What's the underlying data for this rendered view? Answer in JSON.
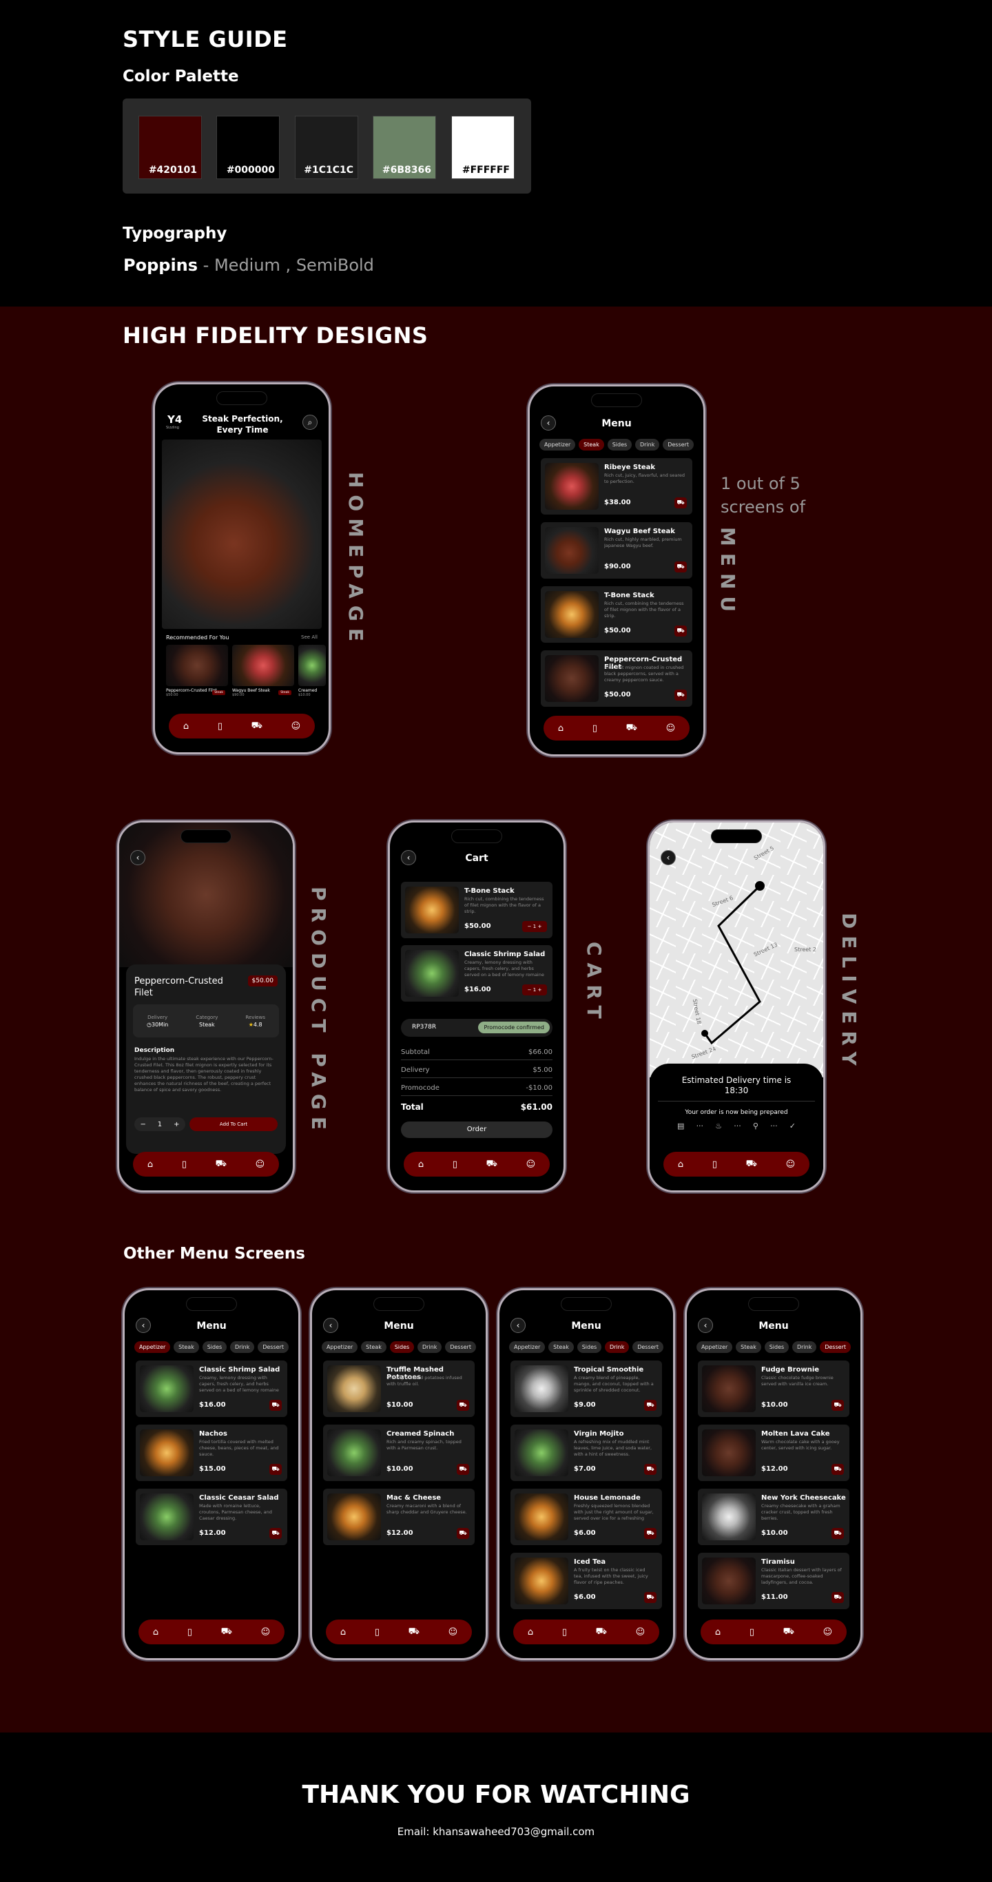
{
  "style_guide": {
    "title": "STYLE GUIDE",
    "palette_heading": "Color Palette",
    "colors": [
      "#420101",
      "#000000",
      "#1C1C1C",
      "#6B8366",
      "#FFFFFF"
    ],
    "typography_heading": "Typography",
    "font_name": "Poppins",
    "font_weights": " - Medium , SemiBold"
  },
  "hifi": {
    "title": "HIGH FIDELITY DESIGNS",
    "menu_note": "1 out of 5 screens of"
  },
  "labels": {
    "homepage": "HOMEPAGE",
    "menu": "MENU",
    "product": "PRODUCT PAGE",
    "cart": "CART",
    "delivery": "DELIVERY"
  },
  "home": {
    "logo": "Y4",
    "logo_sub": "Sizzling",
    "title": "Steak Perfection, Every Time",
    "recommended": "Recommended For You",
    "see_all": "See All",
    "items": [
      {
        "name": "Peppercorn-Crusted Filet",
        "price": "$50.00",
        "tag": "Steak"
      },
      {
        "name": "Wagyu Beef Steak",
        "price": "$90.00",
        "tag": "Steak"
      },
      {
        "name": "Creamed",
        "price": "$10.00"
      }
    ]
  },
  "menu_common": {
    "title": "Menu",
    "tabs": [
      "Appetizer",
      "Steak",
      "Sides",
      "Drink",
      "Dessert"
    ]
  },
  "menu_steak": [
    {
      "name": "Ribeye Steak",
      "desc": "Rich cut, juicy, flavorful, and seared to perfection.",
      "price": "$38.00"
    },
    {
      "name": "Wagyu Beef Steak",
      "desc": "Rich cut, highly marbled, premium Japanese Wagyu beef.",
      "price": "$90.00"
    },
    {
      "name": "T-Bone Stack",
      "desc": "Rich cut, combining the tenderness of filet mignon with the flavor of a strip.",
      "price": "$50.00"
    },
    {
      "name": "Peppercorn-Crusted Filet",
      "desc": "Rich filet mignon coated in crushed black peppercorns, served with a creamy peppercorn sauce.",
      "price": "$50.00"
    }
  ],
  "product": {
    "name": "Peppercorn-Crusted Filet",
    "price": "$50.00",
    "delivery_label": "Delivery",
    "delivery_value": "30Min",
    "category_label": "Category",
    "category_value": "Steak",
    "reviews_label": "Reviews",
    "reviews_value": "4.8",
    "desc_heading": "Description",
    "desc": "Indulge in the ultimate steak experience with our Peppercorn-Crusted Filet. This 8oz filet mignon is expertly selected for its tenderness and flavor, then generously coated in freshly crushed black peppercorns. The robust, peppery crust enhances the natural richness of the beef, creating a perfect balance of spice and savory goodness.",
    "qty": "1",
    "add_label": "Add To Cart"
  },
  "cart": {
    "title": "Cart",
    "items": [
      {
        "name": "T-Bone Stack",
        "desc": "Rich cut, combining the tenderness of filet mignon with the flavor of a strip.",
        "price": "$50.00",
        "qty": "1"
      },
      {
        "name": "Classic Shrimp Salad",
        "desc": "Creamy, lemony dressing with capers, fresh celery, and herbs served on a bed of lemony romaine lettuce.",
        "price": "$16.00",
        "qty": "1"
      }
    ],
    "promo_code": "RP378R",
    "promo_status": "Promocode confirmed",
    "subtotal_label": "Subtotal",
    "subtotal": "$66.00",
    "delivery_label": "Delivery",
    "delivery": "$5.00",
    "promo_label": "Promocode",
    "promo": "-$10.00",
    "total_label": "Total",
    "total": "$61.00",
    "order_label": "Order"
  },
  "delivery": {
    "eta_label": "Estimated Delivery time is",
    "eta": "18:30",
    "status": "Your order is now being prepared",
    "streets": [
      "Street 5",
      "Street 6",
      "Street 13",
      "Street 24",
      "Street 18",
      "Street 2"
    ]
  },
  "other": {
    "title": "Other Menu Screens",
    "appetizer": [
      {
        "name": "Classic Shrimp Salad",
        "desc": "Creamy, lemony dressing with capers, fresh celery, and herbs served on a bed of lemony romaine lettuce.",
        "price": "$16.00"
      },
      {
        "name": "Nachos",
        "desc": "Fried tortilla covered with melted cheese, beans, pieces of meat, and sauce.",
        "price": "$15.00"
      },
      {
        "name": "Classic Ceasar Salad",
        "desc": "Made with romaine lettuce, croutons, Parmesan cheese, and Caesar dressing.",
        "price": "$12.00"
      }
    ],
    "sides": [
      {
        "name": "Truffle Mashed Potatoes",
        "desc": "Creamy mashed potatoes infused with truffle oil.",
        "price": "$10.00"
      },
      {
        "name": "Creamed Spinach",
        "desc": "Rich and creamy spinach, topped with a Parmesan crust.",
        "price": "$10.00"
      },
      {
        "name": "Mac & Cheese",
        "desc": "Creamy macaroni with a blend of sharp cheddar and Gruyere cheese.",
        "price": "$12.00"
      }
    ],
    "drink": [
      {
        "name": "Tropical Smoothie",
        "desc": "A creamy blend of pineapple, mango, and coconut, topped with a sprinkle of shredded coconut.",
        "price": "$9.00"
      },
      {
        "name": "Virgin Mojito",
        "desc": "A refreshing mix of muddled mint leaves, lime juice, and soda water, with a hint of sweetness.",
        "price": "$7.00"
      },
      {
        "name": "House Lemonade",
        "desc": "Freshly squeezed lemons blended with just the right amount of sugar, served over ice for a refreshing treat.",
        "price": "$6.00"
      },
      {
        "name": "Iced Tea",
        "desc": "A fruity twist on the classic iced tea, infused with the sweet, juicy flavor of ripe peaches.",
        "price": "$6.00"
      }
    ],
    "dessert": [
      {
        "name": "Fudge Brownie",
        "desc": "Classic chocolate fudge brownie served with vanilla ice cream.",
        "price": "$10.00"
      },
      {
        "name": "Molten Lava Cake",
        "desc": "Warm chocolate cake with a gooey center, served with icing sugar.",
        "price": "$12.00"
      },
      {
        "name": "New York Cheesecake",
        "desc": "Creamy cheesecake with a graham cracker crust, topped with fresh berries.",
        "price": "$10.00"
      },
      {
        "name": "Tiramisu",
        "desc": "Classic Italian dessert with layers of mascarpone, coffee-soaked ladyfingers, and cocoa.",
        "price": "$11.00"
      }
    ]
  },
  "footer": {
    "thanks": "THANK YOU FOR WATCHING",
    "email": "Email: khansawaheed703@gmail.com"
  }
}
